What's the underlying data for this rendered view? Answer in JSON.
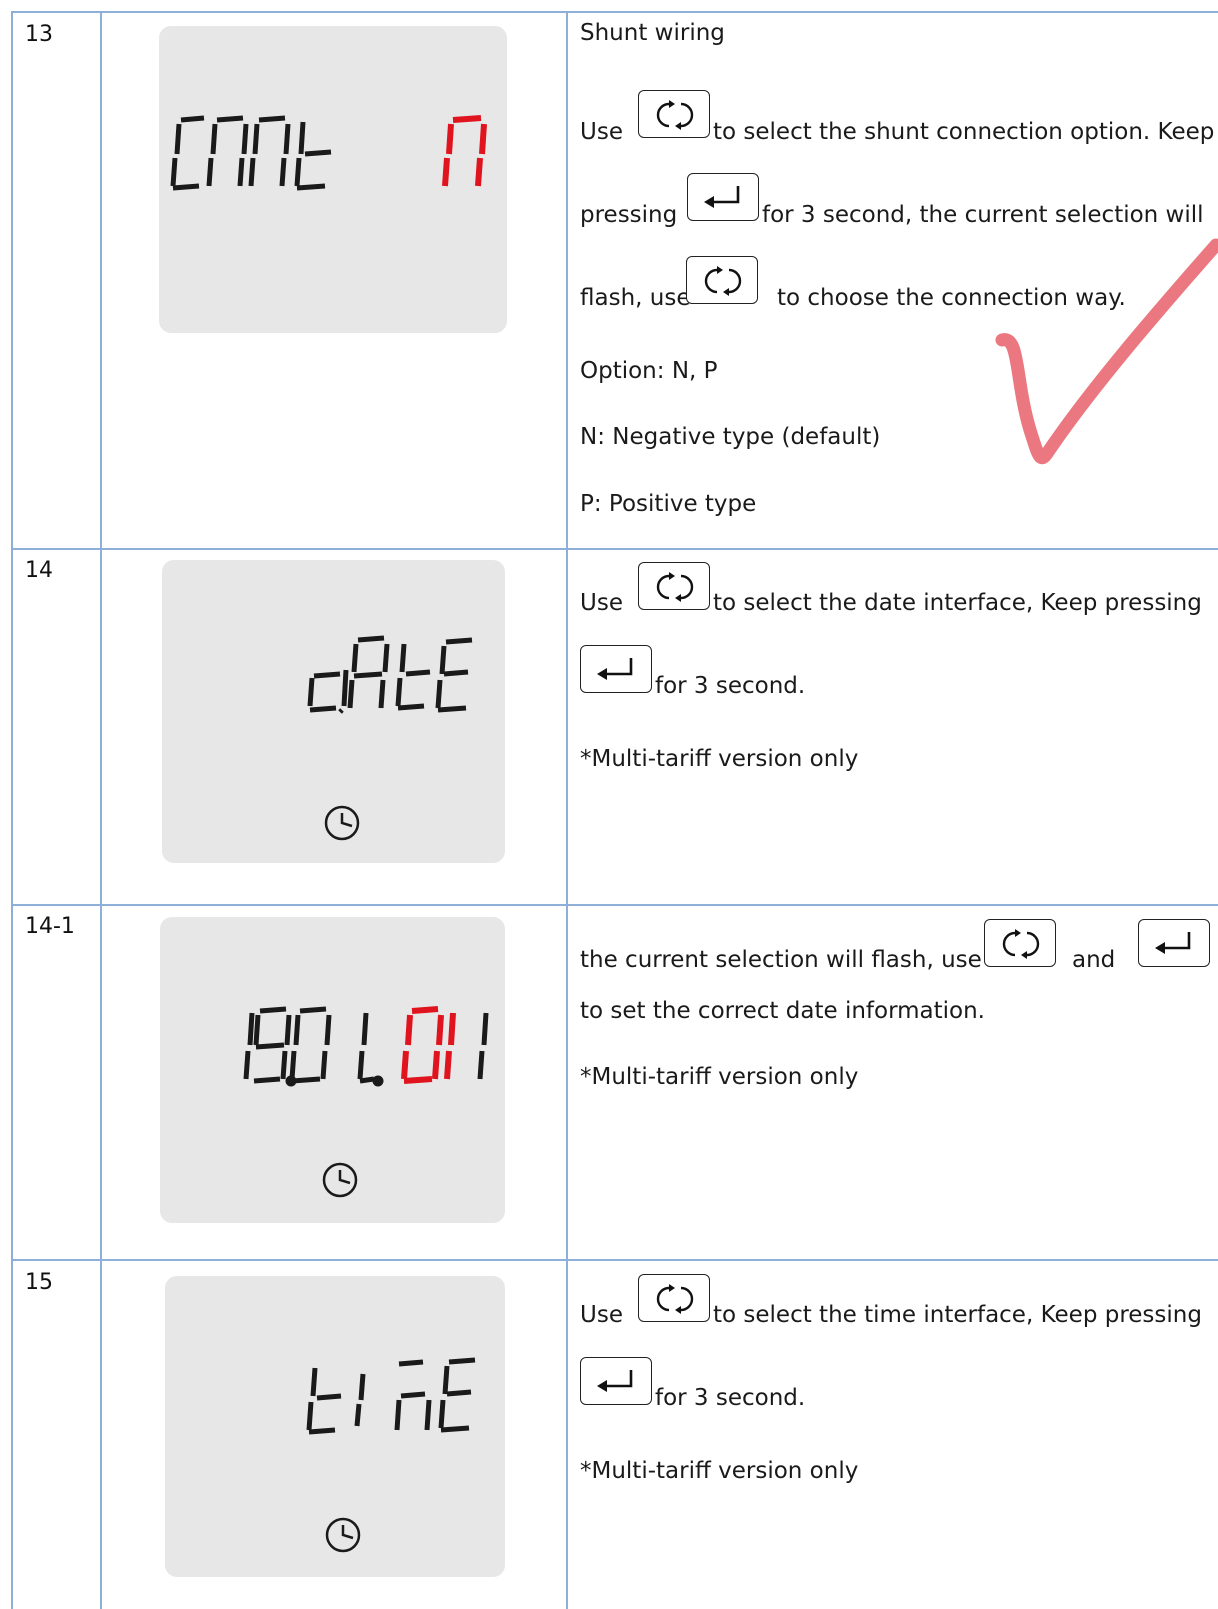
{
  "rows": [
    {
      "id": "13",
      "display": {
        "left_text": "CnnE",
        "right_text": "n",
        "right_color": "#e0141e",
        "clock_icon": false
      },
      "lines": {
        "title": "Shunt wiring",
        "l1a": "Use",
        "l1b": "to select the shunt connection option. Keep",
        "l2a": "pressing",
        "l2b": "for 3 second, the current selection will",
        "l3a": "flash, use",
        "l3b": "to choose the connection way.",
        "l4": "Option: N, P",
        "l5": "N: Negative type (default)",
        "l6": "P: Positive type"
      },
      "buttons": [
        "cycle-icon",
        "enter-icon",
        "cycle-icon"
      ]
    },
    {
      "id": "14",
      "display": {
        "text": "dAtE",
        "clock_icon": true
      },
      "lines": {
        "l1a": "Use",
        "l1b": "to select the date interface, Keep pressing",
        "l2b": "for 3 second.",
        "l3": "*Multi-tariff version only"
      },
      "buttons": [
        "cycle-icon",
        "enter-icon"
      ]
    },
    {
      "id": "14-1",
      "display": {
        "text_black": "19.01.",
        "text_red": "01",
        "red_color": "#e0141e",
        "clock_icon": true
      },
      "lines": {
        "l1a": "the current selection will flash, use",
        "l1b": "and",
        "l2": "to set the correct date information.",
        "l3": "*Multi-tariff version only"
      },
      "buttons": [
        "cycle-icon",
        "enter-icon"
      ]
    },
    {
      "id": "15",
      "display": {
        "text": "tinE",
        "clock_icon": true
      },
      "lines": {
        "l1a": "Use",
        "l1b": "to select the time interface, Keep pressing",
        "l2b": "for 3 second.",
        "l3": "*Multi-tariff version only"
      },
      "buttons": [
        "cycle-icon",
        "enter-icon"
      ]
    }
  ],
  "colors": {
    "grid": "#8eb0d8",
    "lcd_bg": "#e7e7e7",
    "red_digit": "#e0141e",
    "check_mark": "#e8606a"
  }
}
